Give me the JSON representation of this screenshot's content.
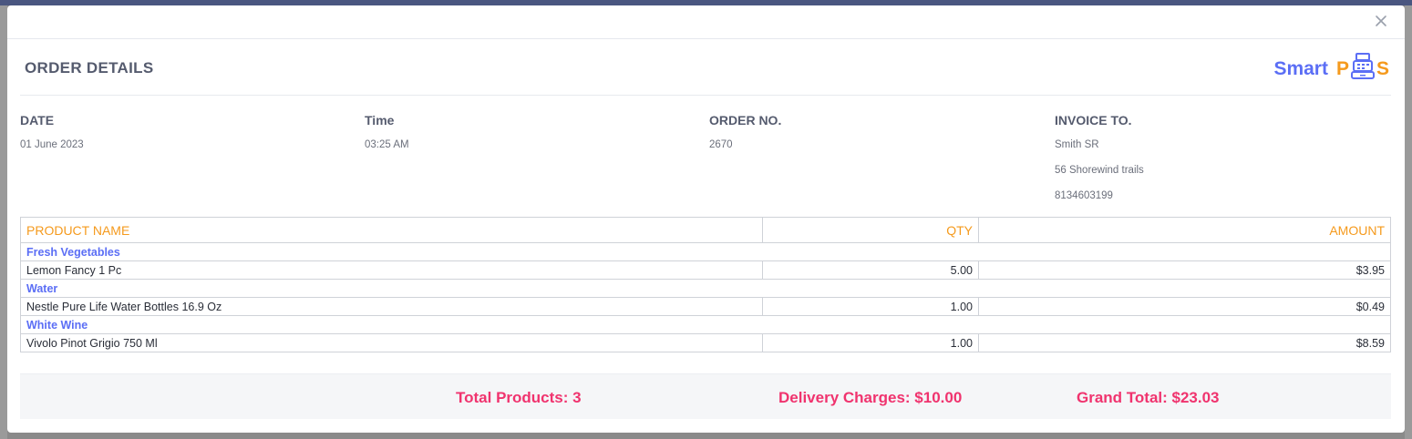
{
  "modal": {
    "title": "ORDER DETAILS",
    "logo": {
      "text_smart": "Smart",
      "text_p": "P",
      "text_s": "S",
      "icon": "cash-register-icon"
    },
    "close_icon": "close-icon"
  },
  "info": {
    "date": {
      "label": "DATE",
      "value": "01 June 2023"
    },
    "time": {
      "label": "Time",
      "value": "03:25 AM"
    },
    "order_no": {
      "label": "ORDER NO.",
      "value": "2670"
    },
    "invoice_to": {
      "label": "INVOICE TO.",
      "name": "Smith SR",
      "address": "56 Shorewind trails",
      "phone": "8134603199"
    }
  },
  "table": {
    "headers": {
      "product": "PRODUCT NAME",
      "qty": "QTY",
      "amount": "AMOUNT"
    },
    "groups": [
      {
        "category": "Fresh Vegetables",
        "product": "Lemon Fancy 1 Pc",
        "qty": "5.00",
        "amount": "$3.95"
      },
      {
        "category": "Water",
        "product": "Nestle Pure Life Water Bottles 16.9 Oz",
        "qty": "1.00",
        "amount": "$0.49"
      },
      {
        "category": "White Wine",
        "product": "Vivolo Pinot Grigio 750 Ml",
        "qty": "1.00",
        "amount": "$8.59"
      }
    ]
  },
  "totals": {
    "total_products": "Total Products: 3",
    "delivery_charges": "Delivery Charges: $10.00",
    "grand_total": "Grand Total: $23.03"
  },
  "colors": {
    "accent_orange": "#f59a1d",
    "accent_blue": "#5b6ef5",
    "accent_pink": "#f0336e",
    "heading": "#555b6e"
  }
}
